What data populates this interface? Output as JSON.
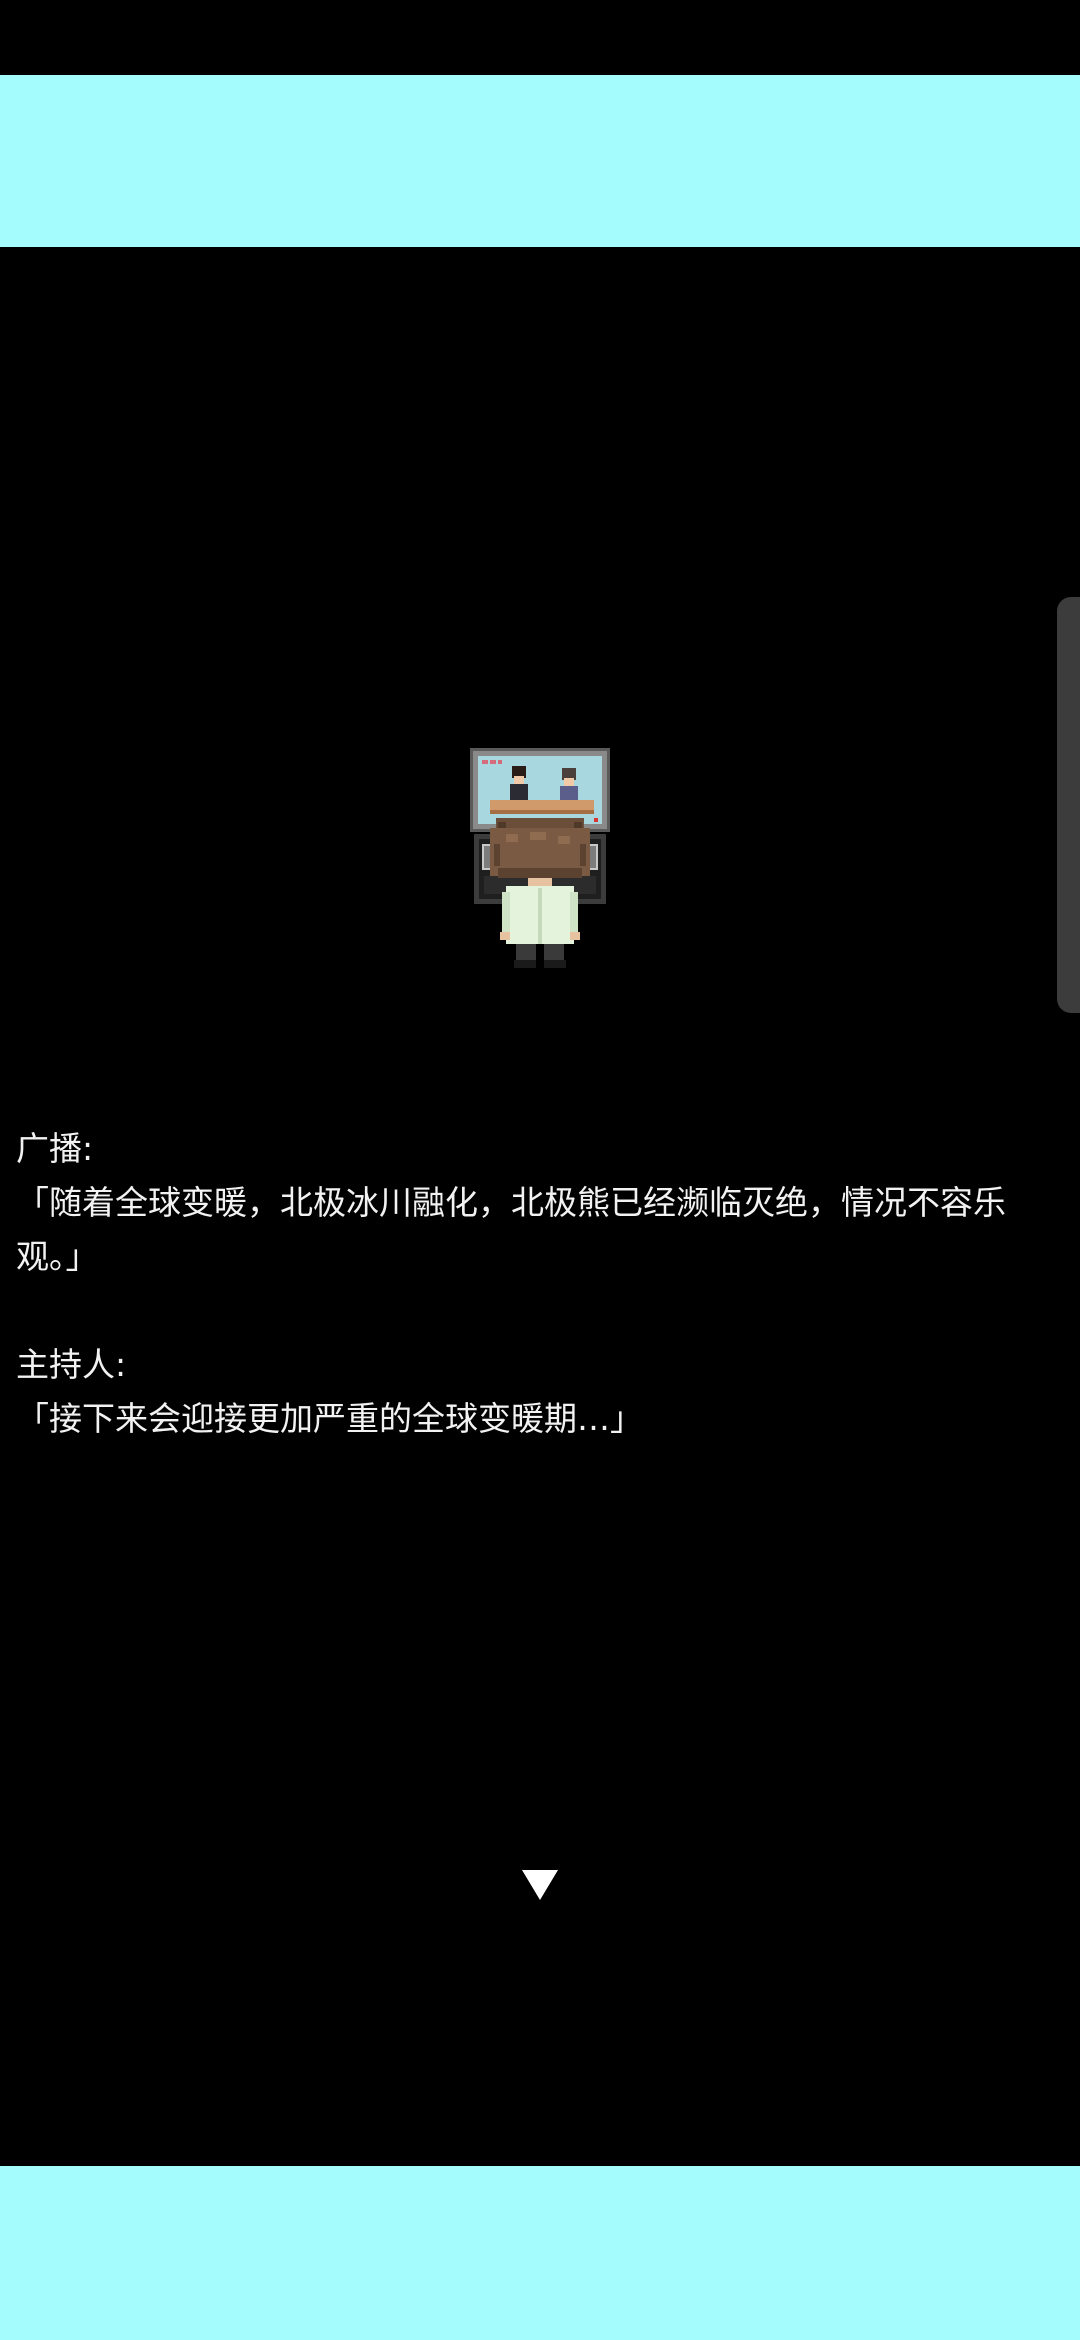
{
  "dialogue": [
    {
      "speaker": "广播:",
      "text": "「随着全球变暖，北极冰川融化，北极熊已经濒临灭绝，情况不容乐观。」"
    },
    {
      "speaker": "主持人:",
      "text": "「接下来会迎接更加严重的全球变暖期…」"
    }
  ],
  "icons": {
    "advance": "triangle-down-icon"
  },
  "colors": {
    "banner": "#a4fdfc",
    "background": "#000000",
    "text": "#f2f2f2"
  }
}
